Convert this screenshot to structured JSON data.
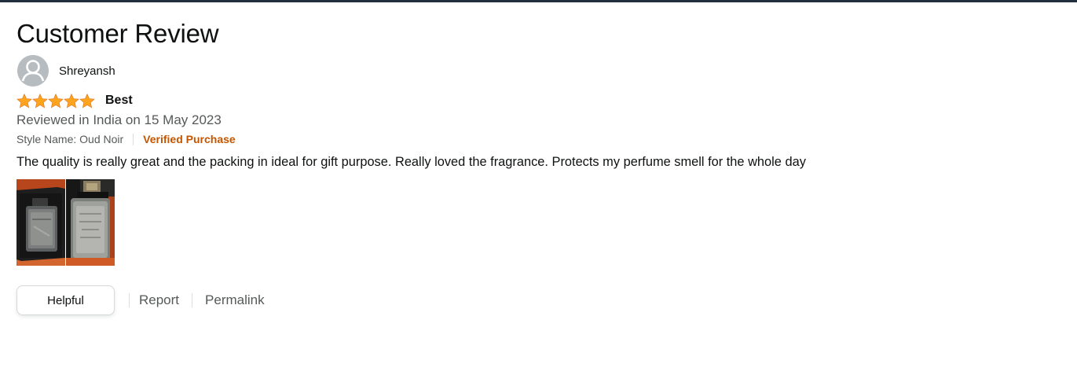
{
  "page": {
    "title": "Customer Review"
  },
  "review": {
    "author_name": "Shreyansh",
    "rating": 5,
    "rating_max": 5,
    "headline": "Best",
    "date_line": "Reviewed in India on 15 May 2023",
    "style_name": "Style Name: Oud Noir",
    "verified_label": "Verified Purchase",
    "body": "The quality is really great and the packing in ideal for gift purpose. Really loved the fragrance. Protects my perfume smell for the whole day",
    "images": [
      {
        "icon": "review-photo-perfume-bottle-box"
      },
      {
        "icon": "review-photo-perfume-bottle-front"
      }
    ]
  },
  "actions": {
    "helpful_label": "Helpful",
    "report_label": "Report",
    "permalink_label": "Permalink"
  },
  "colors": {
    "star": "#ffa41c",
    "verified": "#c45500",
    "secondary_text": "#565959",
    "top_bar": "#232f3e"
  }
}
